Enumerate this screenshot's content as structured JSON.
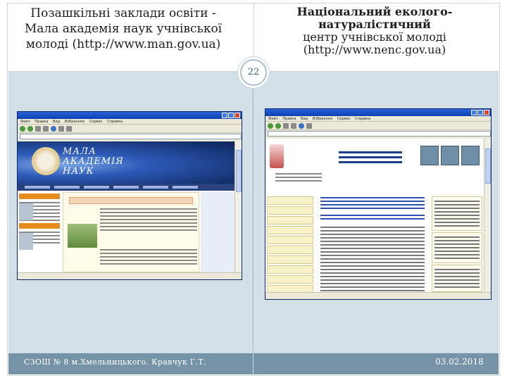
{
  "slide": {
    "title_left": {
      "line1": "Позашкільні заклади освіти -",
      "line2": "Мала академія наук учнівської",
      "line3": "молоді (http://www.man.gov.ua)"
    },
    "title_right": {
      "line1": "Національний еколого-натуралістичний",
      "line2": "центр учнівської молоді",
      "line3": "(http://www.nenc.gov.ua)"
    },
    "page_number": "22",
    "footer_left": "СЗОШ № 8 м.Хмельницького. Кравчук Г.Т.",
    "footer_right": "03.02.2018"
  },
  "browser_man": {
    "menu": [
      "Файл",
      "Правка",
      "Вид",
      "Избранное",
      "Сервис",
      "Справка"
    ],
    "logo_line1": "МАЛА",
    "logo_line2": "АКАДЕМІЯ",
    "logo_line3": "НАУК"
  },
  "browser_nenc": {
    "menu": [
      "Файл",
      "Правка",
      "Вид",
      "Избранное",
      "Сервис",
      "Справка"
    ]
  },
  "colors": {
    "footer_bar": "#7593a6",
    "content_bg": "#d3dfe6",
    "frame_line": "#c8d6df"
  }
}
